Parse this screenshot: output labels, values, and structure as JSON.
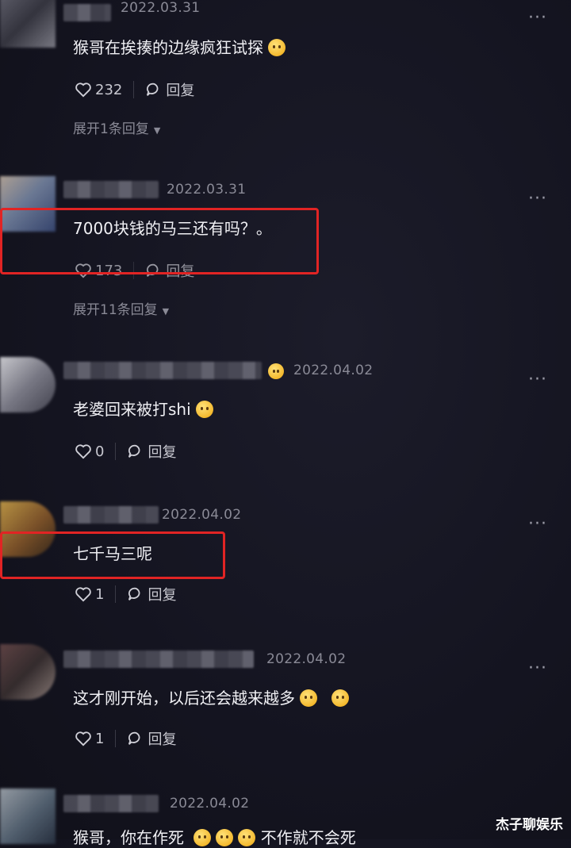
{
  "comments": [
    {
      "date": "2022.03.31",
      "text": "猴哥在挨揍的边缘疯狂试探",
      "likes": "232",
      "reply_label": "回复",
      "expand_label": "展开1条回复"
    },
    {
      "date": "2022.03.31",
      "text": "7000块钱的马三还有吗？。",
      "likes": "173",
      "reply_label": "回复",
      "expand_label": "展开11条回复"
    },
    {
      "date": "2022.04.02",
      "text": "老婆回来被打shi",
      "likes": "0",
      "reply_label": "回复"
    },
    {
      "date": "2022.04.02",
      "text": "七千马三呢",
      "likes": "1",
      "reply_label": "回复"
    },
    {
      "date": "2022.04.02",
      "text": "这才刚开始，以后还会越来越多",
      "likes": "1",
      "reply_label": "回复"
    },
    {
      "date": "2022.04.02",
      "text": "猴哥，你在作死",
      "text_tail": "不作就不会死"
    }
  ],
  "more_icon": "···",
  "watermark": "杰子聊娱乐",
  "accent_highlight": "#e12424"
}
